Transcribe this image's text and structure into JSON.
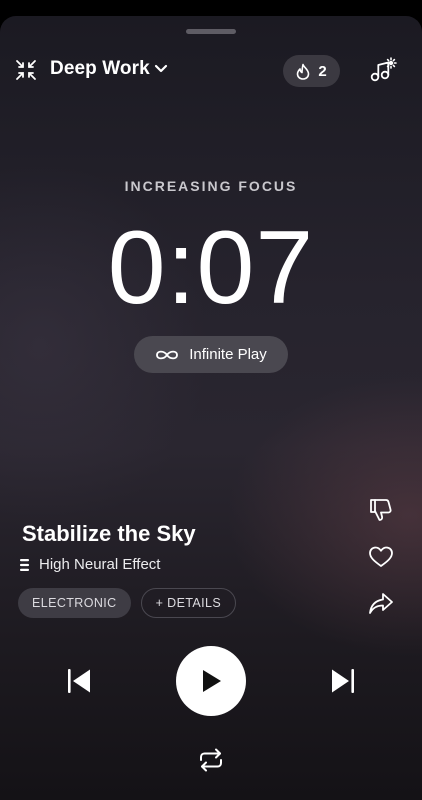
{
  "header": {
    "mode_title": "Deep Work",
    "streak_count": "2",
    "icons": {
      "mode": "compress-arrows-icon",
      "chevron": "chevron-down-icon",
      "streak": "flame-icon",
      "music_settings": "music-settings-icon"
    }
  },
  "session": {
    "focus_label": "INCREASING FOCUS",
    "timer": "0:07",
    "infinite_play_label": "Infinite Play"
  },
  "track": {
    "title": "Stabilize the Sky",
    "effect": "High Neural Effect",
    "tags": [
      "ELECTRONIC",
      "+ DETAILS"
    ]
  },
  "actions": {
    "dislike": "thumbs-down-icon",
    "like": "heart-icon",
    "share": "share-icon"
  },
  "controls": {
    "prev": "skip-previous-icon",
    "play": "play-icon",
    "next": "skip-next-icon",
    "repeat": "repeat-icon"
  },
  "colors": {
    "background": "#1f1c24",
    "pill": "#3b3941",
    "text": "#ffffff",
    "muted": "#c9c8cd"
  }
}
